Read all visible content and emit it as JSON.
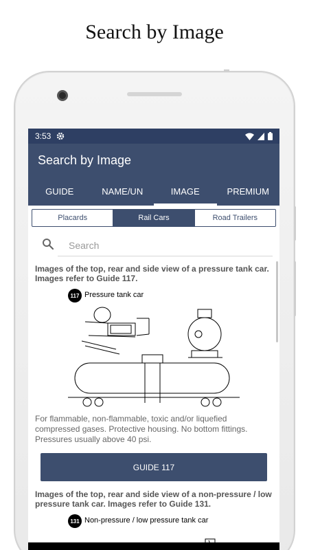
{
  "promo": {
    "title": "Search by Image"
  },
  "status_bar": {
    "time": "3:53"
  },
  "app_bar": {
    "title": "Search by Image"
  },
  "tabs": [
    {
      "label": "GUIDE",
      "active": false
    },
    {
      "label": "NAME/UN",
      "active": false
    },
    {
      "label": "IMAGE",
      "active": true
    },
    {
      "label": "PREMIUM",
      "active": false
    }
  ],
  "segments": [
    {
      "label": "Placards",
      "active": false
    },
    {
      "label": "Rail Cars",
      "active": true
    },
    {
      "label": "Road Trailers",
      "active": false
    }
  ],
  "search": {
    "placeholder": "Search",
    "value": ""
  },
  "cards": [
    {
      "caption": "Images of the top, rear and side view of a pressure tank car. Images refer to Guide 117.",
      "diagram_badge": "117",
      "diagram_title": "Pressure tank car",
      "description": "For flammable, non-flammable, toxic and/or liquefied compressed gases. Protective housing. No bottom fittings. Pressures usually above 40 psi.",
      "button_label": "GUIDE 117"
    },
    {
      "caption": "Images of the top, rear and side view of a non-pressure / low pressure tank car. Images refer to Guide 131.",
      "diagram_badge": "131",
      "diagram_title": "Non-pressure / low pressure tank car"
    }
  ],
  "colors": {
    "primary": "#3d4e6e",
    "status_bar": "#2e3f63"
  }
}
